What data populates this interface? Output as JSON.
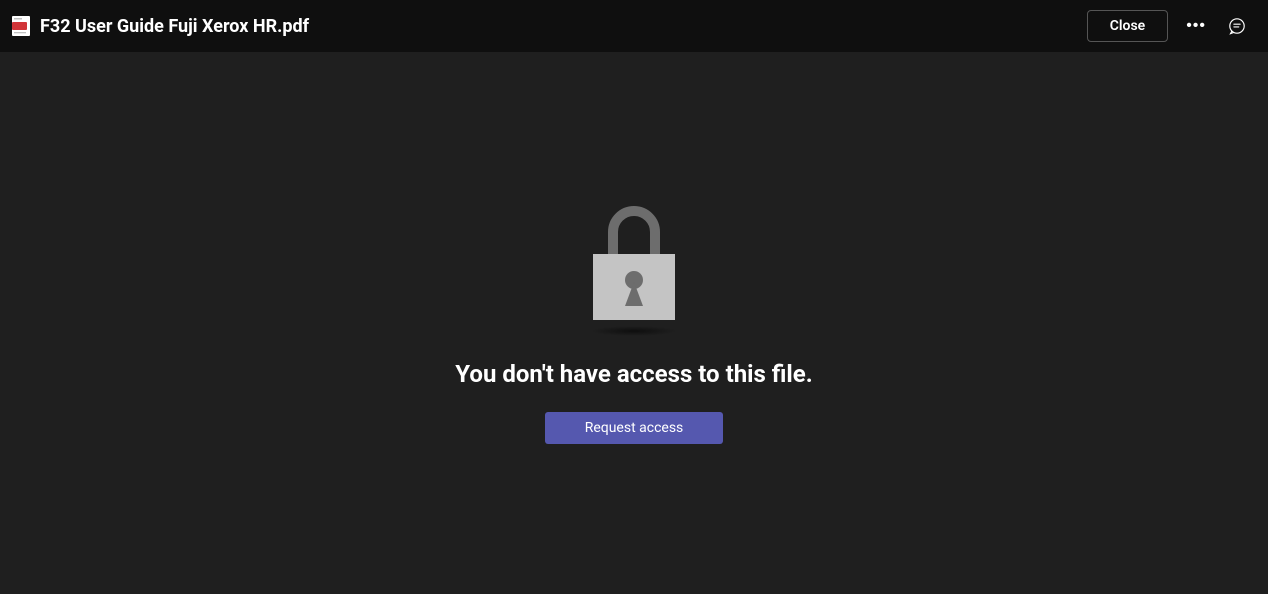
{
  "header": {
    "file_title": "F32 User Guide Fuji Xerox HR.pdf",
    "close_label": "Close"
  },
  "main": {
    "error_message": "You don't have access to this file.",
    "request_label": "Request access"
  }
}
